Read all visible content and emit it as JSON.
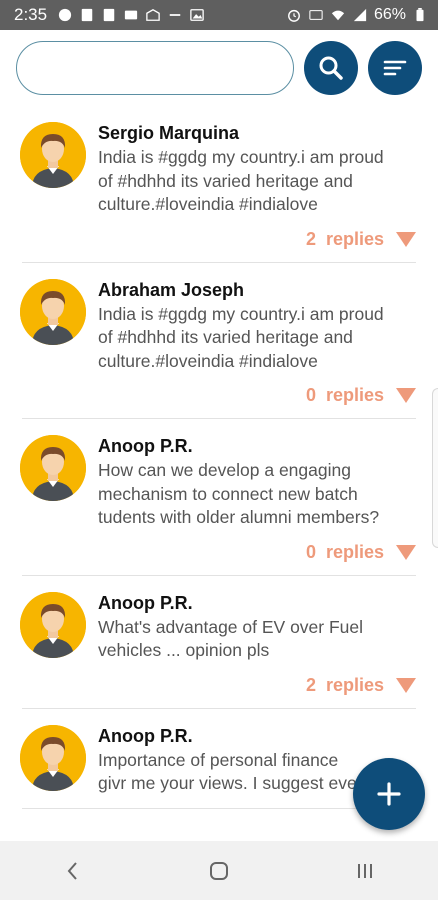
{
  "status_bar": {
    "time": "2:35",
    "battery": "66%"
  },
  "search": {
    "value": "",
    "placeholder": ""
  },
  "posts": [
    {
      "author": "Sergio Marquina",
      "content": "India is #ggdg my country.i am proud\nof #hdhhd its varied heritage and\nculture.#loveindia #indialove",
      "reply_count": "2",
      "replies_label": "replies"
    },
    {
      "author": "Abraham Joseph",
      "content": "India is #ggdg my country.i am proud\nof #hdhhd its varied heritage and\nculture.#loveindia #indialove",
      "reply_count": "0",
      "replies_label": "replies"
    },
    {
      "author": "Anoop P.R.",
      "content": "How can we develop a engaging\nmechanism to connect new batch\ntudents with older alumni members?",
      "reply_count": "0",
      "replies_label": "replies"
    },
    {
      "author": "Anoop P.R.",
      "content": "What's advantage of EV over Fuel\nvehicles ... opinion pls",
      "reply_count": "2",
      "replies_label": "replies"
    },
    {
      "author": "Anoop P.R.",
      "content": "Importance of personal finance\ngivr me your views. I suggest every",
      "reply_count": "",
      "replies_label": ""
    }
  ],
  "colors": {
    "primary": "#0e4d7a",
    "accent": "#ee9a7b",
    "avatar_bg": "#f7b500"
  },
  "icons": {
    "search": "search-icon",
    "filter": "filter-lines-icon",
    "add": "plus-icon",
    "expand": "caret-down-icon"
  }
}
